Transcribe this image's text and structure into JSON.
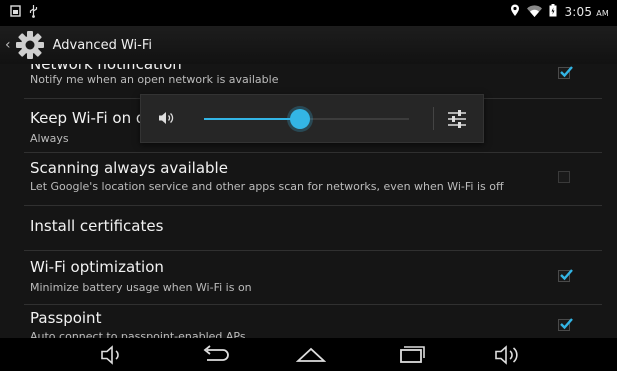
{
  "status_bar": {
    "time": "3:05",
    "ampm": "AM",
    "icons": [
      "screenshot-icon",
      "usb-icon",
      "location-icon",
      "wifi-icon",
      "battery-icon"
    ]
  },
  "action_bar": {
    "title": "Advanced Wi-Fi",
    "icon": "settings-gear-icon"
  },
  "settings": [
    {
      "title": "Network notification",
      "summary": "Notify me when an open network is available",
      "checked": true
    },
    {
      "title": "Keep Wi-Fi on d",
      "summary": "Always"
    },
    {
      "title": "Scanning always available",
      "summary": "Let Google's location service and other apps scan for networks, even when Wi-Fi is off",
      "checked": false
    },
    {
      "title": "Install certificates"
    },
    {
      "title": "Wi-Fi optimization",
      "summary": "Minimize battery usage when Wi-Fi is on",
      "checked": true
    },
    {
      "title": "Passpoint",
      "summary": "Auto connect to passpoint-enabled APs",
      "checked": true
    }
  ],
  "volume_panel": {
    "level": 0.47,
    "icons": [
      "speaker-icon",
      "equalizer-settings-icon"
    ],
    "accent": "#33b5e5"
  },
  "nav_bar": {
    "icons": [
      "volume-down-icon",
      "back-icon",
      "home-icon",
      "recents-icon",
      "volume-up-icon"
    ]
  },
  "colors": {
    "accent": "#33b5e5",
    "background": "#151515"
  }
}
